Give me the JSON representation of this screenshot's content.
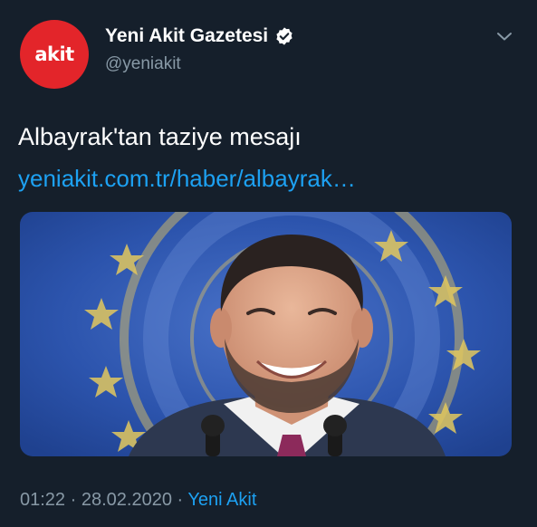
{
  "colors": {
    "background": "#151f2b",
    "accent": "#1da1f2",
    "muted": "#8899a6",
    "avatar_red": "#e3252a"
  },
  "author": {
    "avatar_text": "akit",
    "display_name": "Yeni Akit Gazetesi",
    "handle": "@yeniakit",
    "verified": true
  },
  "icons": {
    "verified": "verified-badge-icon",
    "more": "chevron-down-icon"
  },
  "tweet": {
    "text": "Albayrak'tan taziye mesajı",
    "link_text": "yeniakit.com.tr/haber/albayrak…"
  },
  "meta": {
    "time": "01:22",
    "separator": "·",
    "date": "28.02.2020",
    "source": "Yeni Akit"
  }
}
